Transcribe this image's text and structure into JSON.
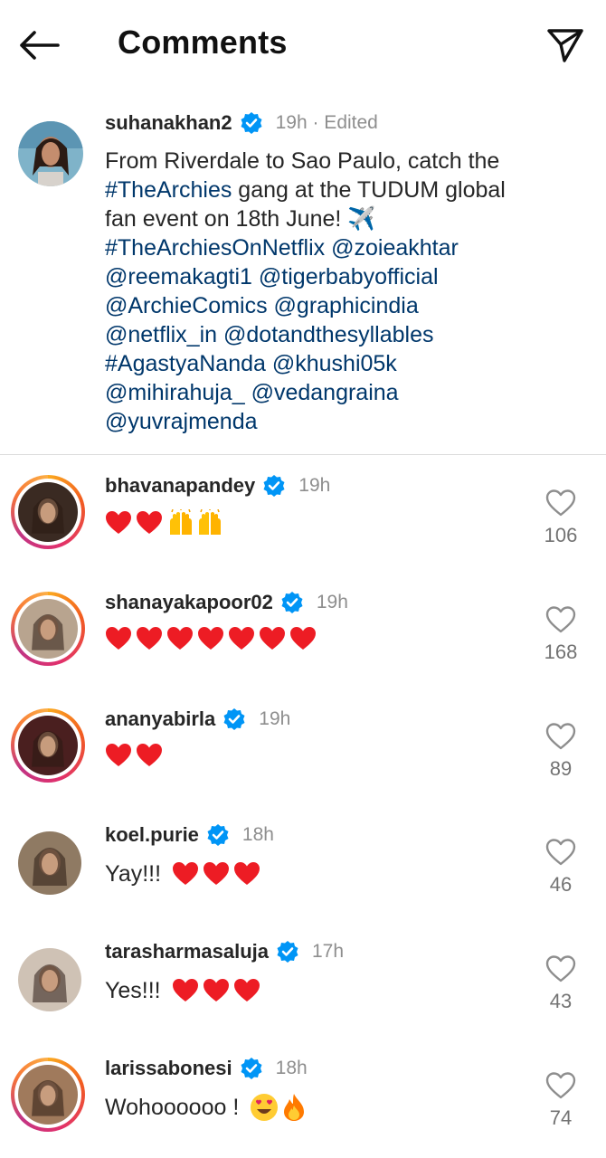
{
  "header": {
    "title": "Comments",
    "back_icon": "arrow-left-icon",
    "share_icon": "paper-plane-icon"
  },
  "colors": {
    "link": "#00376b",
    "verified": "#0095f6",
    "heart_red": "#ed1c24",
    "muted": "#8e8e8e"
  },
  "caption": {
    "username": "suhanakhan2",
    "verified": true,
    "meta": "19h · Edited",
    "tokens": [
      {
        "t": "From Riverdale to Sao Paulo, catch the ",
        "link": false
      },
      {
        "t": "#TheArchies",
        "link": true
      },
      {
        "t": " gang at the TUDUM global fan event on 18th June! ✈️ ",
        "link": false
      },
      {
        "t": "#TheArchiesOnNetflix",
        "link": true
      },
      {
        "t": " ",
        "link": false
      },
      {
        "t": "@zoieakhtar",
        "link": true
      },
      {
        "t": " ",
        "link": false
      },
      {
        "t": "@reemakagti1",
        "link": true
      },
      {
        "t": " ",
        "link": false
      },
      {
        "t": "@tigerbabyofficial",
        "link": true
      },
      {
        "t": " ",
        "link": false
      },
      {
        "t": "@ArchieComics",
        "link": true
      },
      {
        "t": " ",
        "link": false
      },
      {
        "t": "@graphicindia",
        "link": true
      },
      {
        "t": " ",
        "link": false
      },
      {
        "t": "@netflix_in",
        "link": true
      },
      {
        "t": " ",
        "link": false
      },
      {
        "t": "@dotandthesyllables",
        "link": true
      },
      {
        "t": " ",
        "link": false
      },
      {
        "t": "#AgastyaNanda",
        "link": true
      },
      {
        "t": " ",
        "link": false
      },
      {
        "t": "@khushi05k",
        "link": true
      },
      {
        "t": " ",
        "link": false
      },
      {
        "t": "@mihirahuja_",
        "link": true
      },
      {
        "t": " ",
        "link": false
      },
      {
        "t": "@vedangraina",
        "link": true
      },
      {
        "t": " ",
        "link": false
      },
      {
        "t": "@yuvrajmenda",
        "link": true
      }
    ]
  },
  "comments": [
    {
      "username": "bhavanapandey",
      "time": "19h",
      "text": "",
      "hearts": 2,
      "extra": "hands",
      "likes": "106",
      "story": true,
      "avatar_color": "#3a2a22"
    },
    {
      "username": "shanayakapoor02",
      "time": "19h",
      "text": "",
      "hearts": 7,
      "extra": "",
      "likes": "168",
      "story": true,
      "avatar_color": "#b8a48f"
    },
    {
      "username": "ananyabirla",
      "time": "19h",
      "text": "",
      "hearts": 2,
      "extra": "",
      "likes": "89",
      "story": true,
      "avatar_color": "#4a1f1f"
    },
    {
      "username": "koel.purie",
      "time": "18h",
      "text": "Yay!!!",
      "hearts": 3,
      "extra": "",
      "likes": "46",
      "story": false,
      "avatar_color": "#8f7a63"
    },
    {
      "username": "tarasharmasaluja",
      "time": "17h",
      "text": "Yes!!!",
      "hearts": 3,
      "extra": "",
      "likes": "43",
      "story": false,
      "avatar_color": "#cfc2b5"
    },
    {
      "username": "larissabonesi",
      "time": "18h",
      "text": "Wohoooooo !",
      "hearts": 0,
      "extra": "heart-eyes-fire",
      "likes": "74",
      "story": true,
      "avatar_color": "#a07a5c"
    }
  ]
}
